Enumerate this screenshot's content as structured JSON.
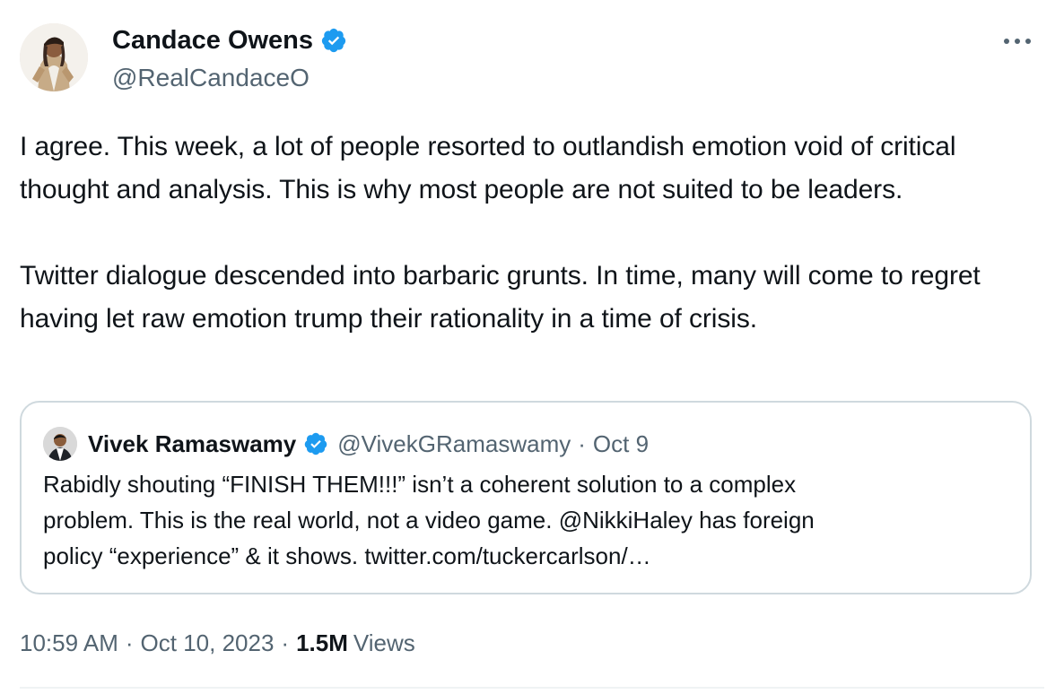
{
  "author": {
    "name": "Candace Owens",
    "handle": "@RealCandaceO",
    "verified": true,
    "avatar": "profile-photo"
  },
  "tweet": {
    "paragraphs": [
      "I agree. This week, a lot of people resorted to outlandish emotion void of critical thought and analysis. This is why most people are not suited to be leaders.",
      "Twitter dialogue descended into barbaric grunts. In time, many will come to regret having let raw emotion trump their rationality in a time of crisis."
    ]
  },
  "quote": {
    "name": "Vivek Ramaswamy",
    "handle": "@VivekGRamaswamy",
    "separator": "·",
    "date": "Oct 9",
    "verified": true,
    "lines": [
      "Rabidly shouting “FINISH THEM!!!” isn’t a coherent solution to a complex",
      "problem. This is the real world, not a video game. @NikkiHaley has foreign",
      "policy “experience” & it shows. twitter.com/tuckercarlson/…"
    ]
  },
  "footer": {
    "time": "10:59 AM",
    "separator": "·",
    "date": "Oct 10, 2023",
    "views_count": "1.5M",
    "views_label": "Views"
  },
  "icons": {
    "verified": "verified-badge-icon",
    "more": "more-icon"
  },
  "colors": {
    "verified_blue": "#1d9bf0",
    "text_primary": "#0f1419",
    "text_secondary": "#536471",
    "border": "#cfd9de"
  }
}
